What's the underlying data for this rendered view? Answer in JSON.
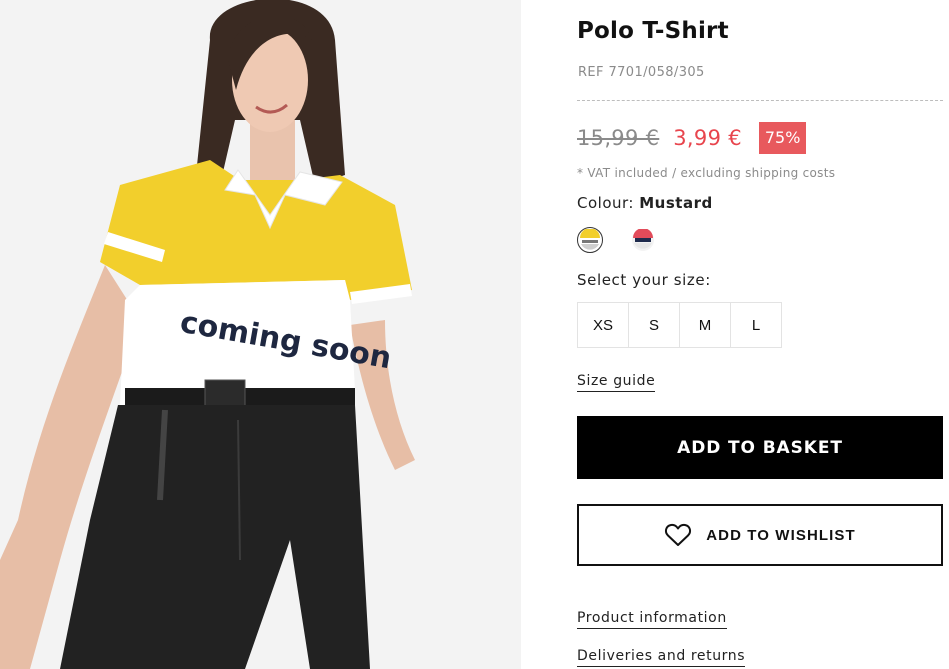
{
  "product": {
    "title": "Polo T-Shirt",
    "ref": "REF 7701/058/305",
    "price_old": "15,99 €",
    "price_new": "3,99 €",
    "discount": "75%",
    "vat_note": "* VAT included / excluding shipping costs",
    "image_print_text": "coming soon"
  },
  "colour": {
    "label": "Colour:",
    "selected": "Mustard",
    "swatches": [
      {
        "name": "Mustard",
        "selected": true
      },
      {
        "name": "Alternate print",
        "selected": false
      }
    ]
  },
  "sizes": {
    "label": "Select your size:",
    "options": [
      "XS",
      "S",
      "M",
      "L"
    ]
  },
  "links": {
    "size_guide": "Size guide",
    "product_information": "Product information",
    "deliveries_returns": "Deliveries and returns"
  },
  "actions": {
    "add_to_basket": "ADD TO BASKET",
    "add_to_wishlist": "ADD TO WISHLIST"
  },
  "colors": {
    "sale_price": "#e8454d",
    "discount_badge": "#e8595d",
    "primary_button": "#000000",
    "shirt_yellow": "#f2cf2c"
  },
  "icons": {
    "wishlist": "heart-outline-icon"
  }
}
